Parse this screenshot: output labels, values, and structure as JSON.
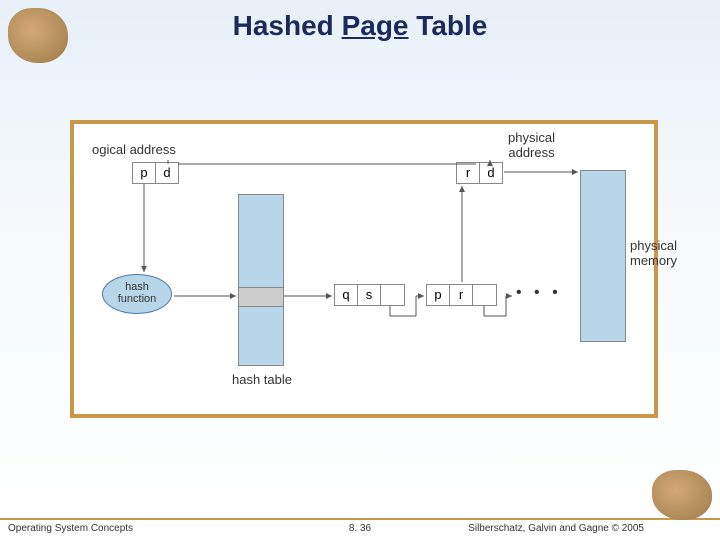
{
  "title_parts": {
    "a": "Hashed ",
    "b": "Page",
    "c": " Table"
  },
  "labels": {
    "logical_addr": "ogical address",
    "physical_addr": "physical\naddress",
    "hash_func": "hash\nfunction",
    "hash_table": "hash table",
    "physical_memory": "physical\nmemory",
    "p": "p",
    "d": "d",
    "r": "r",
    "q": "q",
    "s": "s",
    "ellipsis": "• • •"
  },
  "footer": {
    "left": "Operating System Concepts",
    "center": "8. 36",
    "right": "Silberschatz, Galvin and Gagne © 2005"
  }
}
